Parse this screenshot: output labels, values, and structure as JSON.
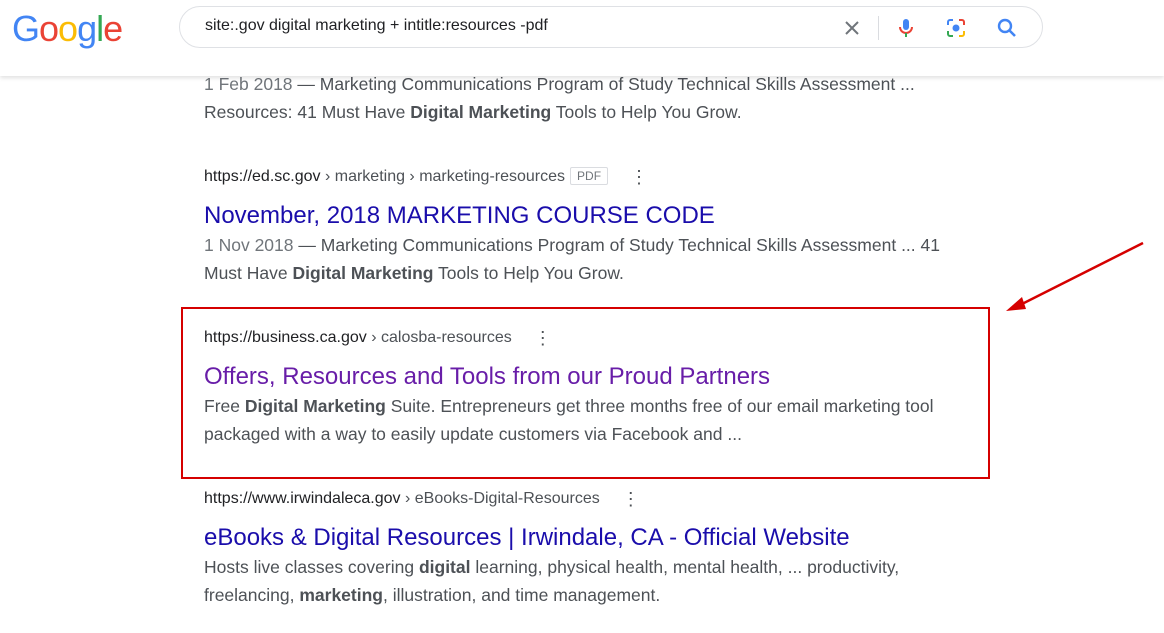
{
  "logo": {
    "letters": [
      "G",
      "o",
      "o",
      "g",
      "l",
      "e"
    ],
    "colors": [
      "#4285f4",
      "#ea4335",
      "#fbbc05",
      "#4285f4",
      "#34a853",
      "#ea4335"
    ]
  },
  "search": {
    "query": "site:.gov digital marketing + intitle:resources -pdf"
  },
  "colors": {
    "link": "#1a0dab",
    "visited": "#681da8",
    "highlight": "#d50000"
  },
  "results": [
    {
      "snippet_line1": {
        "date": "1 Feb 2018",
        "text": " — Marketing Communications Program of Study Technical Skills Assessment ..."
      },
      "snippet_line2": {
        "pre": "Resources: 41 Must Have ",
        "bold": "Digital Marketing",
        "post": " Tools to Help You Grow."
      }
    },
    {
      "url_host": "https://ed.sc.gov",
      "url_path": " › marketing › marketing-resources",
      "badge": "PDF",
      "title": "November, 2018 MARKETING COURSE CODE",
      "snippet_line1": {
        "date": "1 Nov 2018",
        "text": " — Marketing Communications Program of Study Technical Skills Assessment ... 41"
      },
      "snippet_line2": {
        "pre": "Must Have ",
        "bold": "Digital Marketing",
        "post": " Tools to Help You Grow."
      }
    },
    {
      "url_host": "https://business.ca.gov",
      "url_path": " › calosba-resources",
      "title": "Offers, Resources and Tools from our Proud Partners",
      "snippet_line1": {
        "pre": "Free ",
        "bold": "Digital Marketing",
        "post": " Suite. Entrepreneurs get three months free of our email marketing tool"
      },
      "snippet_line2": {
        "text": "packaged with a way to easily update customers via Facebook and ..."
      }
    },
    {
      "url_host": "https://www.irwindaleca.gov",
      "url_path": " › eBooks-Digital-Resources",
      "title": "eBooks & Digital Resources | Irwindale, CA - Official Website",
      "snippet_line1": {
        "pre": "Hosts live classes covering ",
        "bold": "digital",
        "post": " learning, physical health, mental health, ... productivity,"
      },
      "snippet_line2": {
        "pre": "freelancing, ",
        "bold": "marketing",
        "post": ", illustration, and time management."
      }
    }
  ]
}
